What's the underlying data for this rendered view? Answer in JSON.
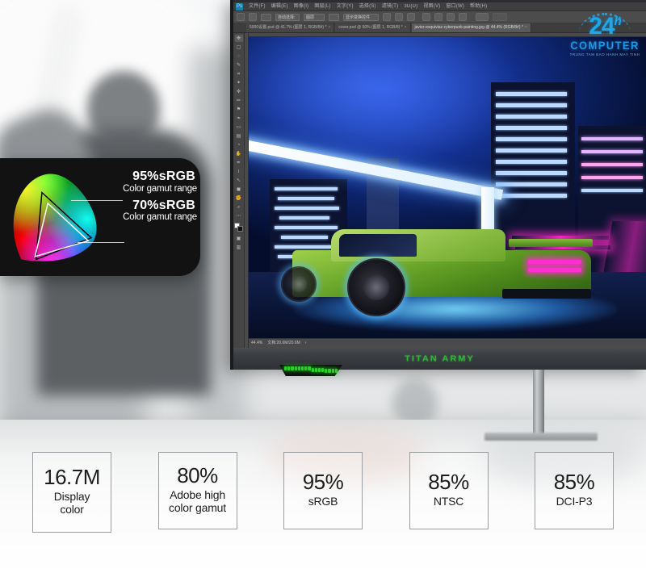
{
  "page": {
    "title": "TITAN ARMY monitor color gamut marketing banner"
  },
  "monitor": {
    "brand": "TITAN ARMY",
    "rgb_light_color": "#2ad22a",
    "bezel_color": "#2b2d30"
  },
  "photoshop": {
    "app_icon": "photoshop-icon",
    "menu_items": [
      "文件(F)",
      "编辑(E)",
      "图像(I)",
      "图层(L)",
      "文字(Y)",
      "选择(S)",
      "滤镜(T)",
      "3D(D)",
      "视图(V)",
      "窗口(W)",
      "帮助(H)"
    ],
    "options_bar": {
      "home_icon": "home-icon",
      "move_icon": "move-tool-icon",
      "auto_select_label": "自动选择:",
      "layer_select_value": "图层",
      "show_transform_label": "显示变换控件",
      "align_icons": [
        "align-left-icon",
        "align-center-icon",
        "align-right-icon",
        "align-top-icon",
        "align-middle-icon",
        "align-bottom-icon",
        "distribute-icon"
      ],
      "more_icon": "more-options-icon"
    },
    "document_tabs": [
      {
        "label": "5000设置.psd @ 41.7% (图层 1, RGB/8#) *",
        "active": false
      },
      {
        "label": "cover.psd @ 50% (图层 1, RGB/8) *",
        "active": false
      },
      {
        "label": "javier-esquiviaz-cyberpunk-painting.jpg @ 44.4% (RGB/8#) *",
        "active": true
      }
    ],
    "toolbar_tools": [
      "move-tool-icon",
      "marquee-tool-icon",
      "lasso-tool-icon",
      "quick-select-tool-icon",
      "crop-tool-icon",
      "eyedropper-tool-icon",
      "healing-brush-tool-icon",
      "brush-tool-icon",
      "clone-stamp-tool-icon",
      "history-brush-tool-icon",
      "eraser-tool-icon",
      "gradient-tool-icon",
      "blur-tool-icon",
      "dodge-tool-icon",
      "pen-tool-icon",
      "type-tool-icon",
      "path-select-tool-icon",
      "shape-tool-icon",
      "hand-tool-icon",
      "zoom-tool-icon",
      "more-tools-icon"
    ],
    "foreground_color": "#ffffff",
    "background_color": "#111111",
    "status_bar": {
      "zoom": "44.4%",
      "doc_size": "文档:20.6M/20.6M"
    },
    "canvas_artwork": "neon-cyberpunk-sports-car"
  },
  "gamut_card": {
    "diagram": "cie-chromaticity-diagram",
    "rows": [
      {
        "value": "95%sRGB",
        "caption": "Color gamut range"
      },
      {
        "value": "70%sRGB",
        "caption": "Color gamut range"
      }
    ]
  },
  "specs": [
    {
      "value": "16.7M",
      "label": "Display\ncolor"
    },
    {
      "value": "80%",
      "label": "Adobe high\ncolor gamut"
    },
    {
      "value": "95%",
      "label": "sRGB"
    },
    {
      "value": "85%",
      "label": "NTSC"
    },
    {
      "value": "85%",
      "label": "DCI-P3"
    }
  ],
  "watermark": {
    "number": "24",
    "superscript": "h",
    "name": "COMPUTER",
    "tagline": "TRUNG TAM BAO HANH MAY TINH"
  }
}
